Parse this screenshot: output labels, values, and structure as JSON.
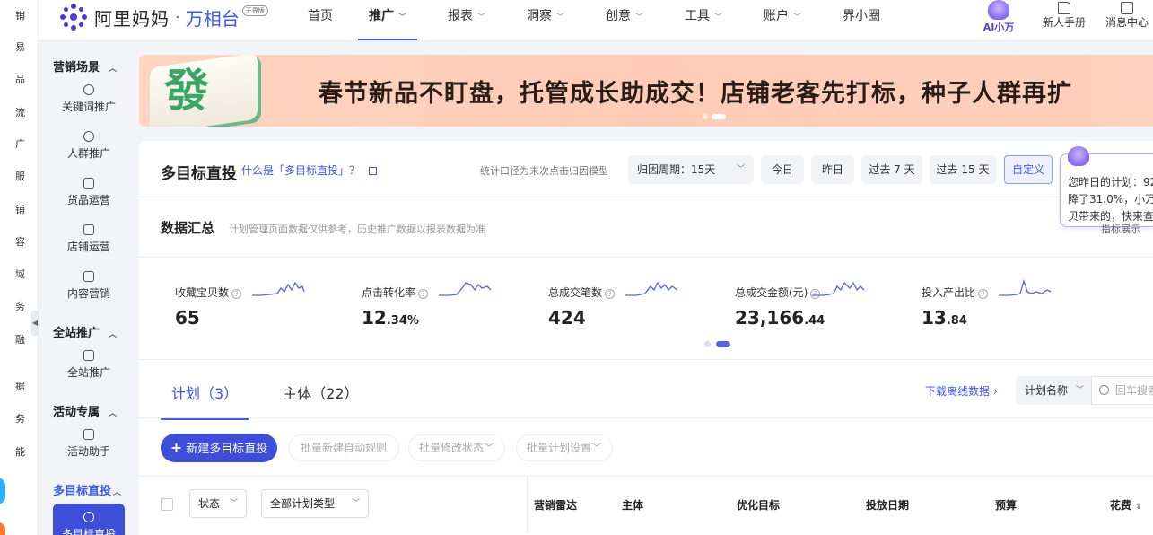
{
  "far_left": {
    "items": [
      "销",
      "易",
      "品",
      "流",
      "广",
      "服",
      "铺",
      "容",
      "域",
      "务",
      "融",
      "据",
      "务",
      "能"
    ]
  },
  "header": {
    "logo_main": "阿里妈妈",
    "logo_dot": "·",
    "logo_product": "万相台",
    "logo_badge": "无界版",
    "nav": [
      {
        "label": "首页",
        "chevron": false
      },
      {
        "label": "推广",
        "chevron": true,
        "active": true
      },
      {
        "label": "报表",
        "chevron": true
      },
      {
        "label": "洞察",
        "chevron": true
      },
      {
        "label": "创意",
        "chevron": true
      },
      {
        "label": "工具",
        "chevron": true
      },
      {
        "label": "账户",
        "chevron": true
      },
      {
        "label": "界小圈",
        "chevron": false
      }
    ],
    "ai_label": "AI小万",
    "newbie_label": "新人手册",
    "message_label": "消息中心"
  },
  "sidebar": {
    "groups": [
      {
        "label": "营销场景",
        "items": [
          "关键词推广",
          "人群推广",
          "货品运营",
          "店铺运营",
          "内容营销"
        ]
      },
      {
        "label": "全站推广",
        "items": [
          "全站推广"
        ]
      },
      {
        "label": "活动专属",
        "items": [
          "活动助手"
        ]
      },
      {
        "label": "多目标直投",
        "items": [
          "多目标直投"
        ]
      }
    ]
  },
  "banner": {
    "tile_char": "發",
    "text": "春节新品不盯盘，托管成长助成交！店铺老客先打标，种子人群再扩"
  },
  "card": {
    "title": "多目标直投",
    "help_link": "什么是「多目标直投」？",
    "attr_note": "统计口径为末次点击归因模型",
    "period_label": "归因周期：",
    "period_value": "15天",
    "date_buttons": [
      "今日",
      "昨日",
      "过去 7 天",
      "过去 15 天",
      "自定义"
    ],
    "summary_title": "数据汇总",
    "summary_note": "计划管理页面数据仅供参考，历史推广数据以报表数据为准",
    "metrics": [
      {
        "label": "收藏宝贝数",
        "int": "65",
        "dec": ""
      },
      {
        "label": "点击转化率",
        "int": "12",
        "dec": ".34%"
      },
      {
        "label": "总成交笔数",
        "int": "424",
        "dec": ""
      },
      {
        "label": "总成交金额(元)",
        "int": "23,166",
        "dec": ".44"
      },
      {
        "label": "投入产出比",
        "int": "13",
        "dec": ".84"
      }
    ],
    "tabs": [
      "计划（3）",
      "主体（22）"
    ],
    "download_link": "下载离线数据",
    "plan_select": "计划名称",
    "search_placeholder": "回车搜索",
    "new_button": "新建多目标直投",
    "batch_buttons": [
      "批量新建自动规则",
      "批量修改状态",
      "批量计划设置"
    ],
    "filter_status": "状态",
    "filter_type": "全部计划类型",
    "columns": [
      "营销雷达",
      "主体",
      "优化目标",
      "投放日期",
      "预算",
      "花费"
    ]
  },
  "ai_tip": {
    "line1": "您昨日的计划：92",
    "line2": "降了31.0%，小万",
    "line3": "贝带来的，快来查",
    "under": "指标展示"
  },
  "colors": {
    "accent": "#3d5ae8",
    "primary_button": "#3d4fd8",
    "banner_bg": "#ffcbb7"
  }
}
